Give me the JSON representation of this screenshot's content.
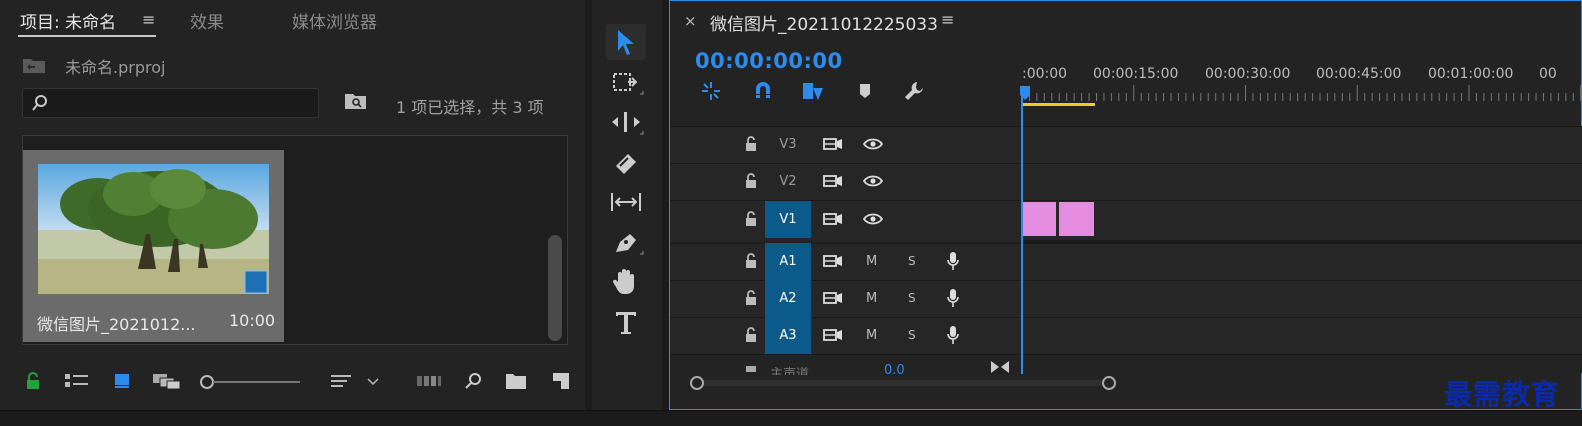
{
  "project_panel": {
    "tabs": [
      {
        "label": "项目: 未命名",
        "active": true
      },
      {
        "label": "效果",
        "active": false
      },
      {
        "label": "媒体浏览器",
        "active": false
      }
    ],
    "tab_menu_icon": "hamburger-icon",
    "project_file": "未命名.prproj",
    "search": {
      "placeholder": "",
      "value": ""
    },
    "selection_status": "1 项已选择，共 3 项",
    "clip": {
      "name": "微信图片_2021012...",
      "duration": "10:00"
    },
    "toolbar_icons": [
      "lock-icon",
      "list-view-icon",
      "icon-view-icon",
      "freeform-view-icon",
      "zoom-slider",
      "sort-icon",
      "automate-icon",
      "find-icon",
      "new-bin-icon",
      "new-item-icon"
    ]
  },
  "tools": [
    "selection-tool",
    "track-select-tool",
    "ripple-edit-tool",
    "razor-tool",
    "slip-tool",
    "pen-tool",
    "hand-tool",
    "type-tool"
  ],
  "timeline": {
    "sequence_title": "微信图片_20211012225033",
    "close_glyph": "×",
    "menu_glyph": "≡",
    "timecode": "00:00:00:00",
    "ruler_labels": [
      ":00:00",
      "00:00:15:00",
      "00:00:30:00",
      "00:00:45:00",
      "00:01:00:00",
      "00"
    ],
    "video_tracks": [
      {
        "label": "V3",
        "targeted": false
      },
      {
        "label": "V2",
        "targeted": false
      },
      {
        "label": "V1",
        "targeted": true
      }
    ],
    "audio_tracks": [
      {
        "label": "A1",
        "targeted": true,
        "mute": "M",
        "solo": "S"
      },
      {
        "label": "A2",
        "targeted": true,
        "mute": "M",
        "solo": "S"
      },
      {
        "label": "A3",
        "targeted": true,
        "mute": "M",
        "solo": "S"
      }
    ],
    "master": {
      "label": "主声道",
      "value": "0.0"
    },
    "clip_color": "#e38ce0",
    "accent_color": "#2d8ceb"
  },
  "watermark": "最需教育"
}
